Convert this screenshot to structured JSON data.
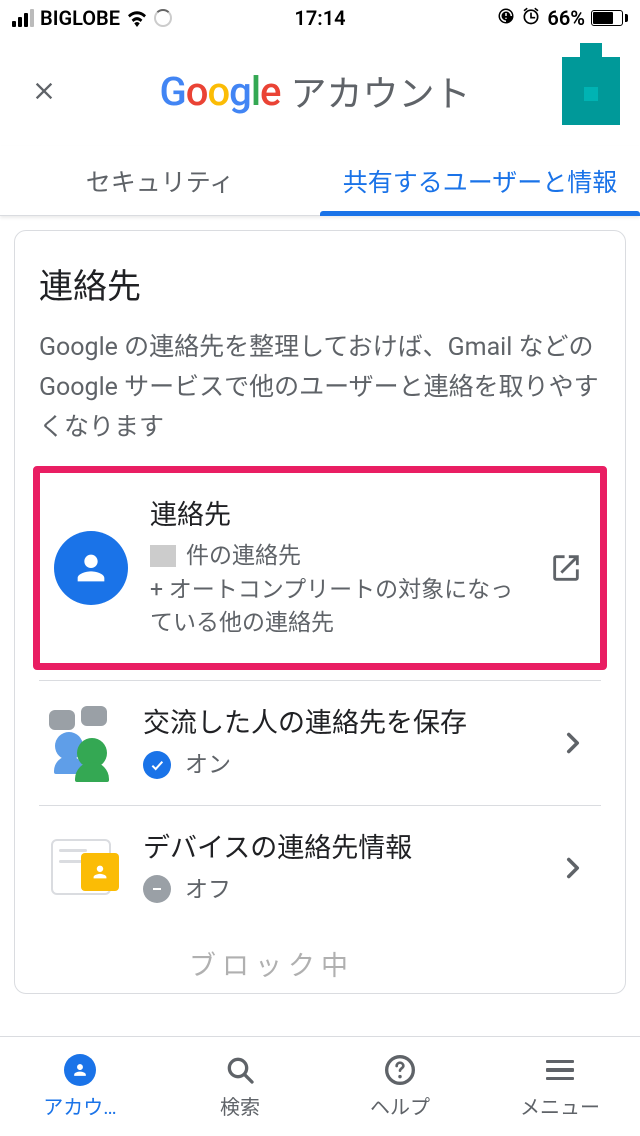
{
  "status_bar": {
    "carrier": "BIGLOBE",
    "time": "17:14",
    "battery_percent": "66%"
  },
  "header": {
    "logo_text": "Google",
    "title": "アカウント"
  },
  "tabs": [
    {
      "label": "セキュリティ",
      "active": false
    },
    {
      "label": "共有するユーザーと情報",
      "active": true
    }
  ],
  "card": {
    "title": "連絡先",
    "description": "Google の連絡先を整理しておけば、Gmail などの Google サービスで他のユーザーと連絡を取りやすくなります"
  },
  "items": [
    {
      "title": "連絡先",
      "sub_line1_suffix": "件の連絡先",
      "sub_line2": "+ オートコンプリートの対象になっている他の連絡先"
    },
    {
      "title": "交流した人の連絡先を保存",
      "status_label": "オン",
      "status_on": true
    },
    {
      "title": "デバイスの連絡先情報",
      "status_label": "オフ",
      "status_on": false
    }
  ],
  "partial_next": "ブロック中",
  "bottom_nav": [
    {
      "label": "アカウ…"
    },
    {
      "label": "検索"
    },
    {
      "label": "ヘルプ"
    },
    {
      "label": "メニュー"
    }
  ]
}
